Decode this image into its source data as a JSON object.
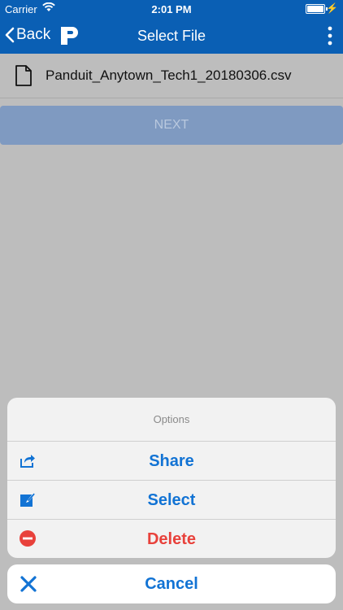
{
  "status_bar": {
    "carrier": "Carrier",
    "time": "2:01 PM"
  },
  "nav": {
    "back_label": "Back",
    "title": "Select File"
  },
  "file": {
    "name": "Panduit_Anytown_Tech1_20180306.csv"
  },
  "next_label": "NEXT",
  "sheet": {
    "title": "Options",
    "options": [
      {
        "label": "Share",
        "icon": "share-icon",
        "color": "#1273d4"
      },
      {
        "label": "Select",
        "icon": "edit-icon",
        "color": "#1273d4"
      },
      {
        "label": "Delete",
        "icon": "delete-icon",
        "color": "#e8413b"
      }
    ],
    "cancel": {
      "label": "Cancel",
      "icon": "close-icon",
      "color": "#1273d4"
    }
  },
  "colors": {
    "nav_bg": "#0a5fb4",
    "overlay": "#bdbdbd",
    "accent": "#1273d4",
    "danger": "#e8413b"
  }
}
